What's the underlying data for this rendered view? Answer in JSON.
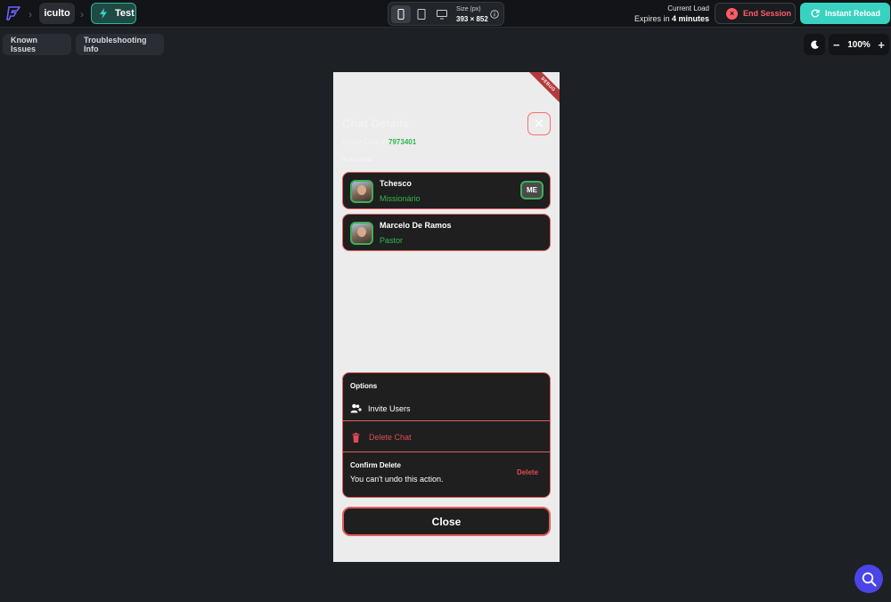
{
  "topbar": {
    "project_name": "iculto",
    "test_label": "Test",
    "size_label": "Size (px)",
    "size_value": "393 × 852",
    "load_label": "Current Load",
    "expires_prefix": "Expires in",
    "expires_value": "4 minutes",
    "end_session_label": "End Session",
    "instant_reload_label": "Instant Reload"
  },
  "subbar": {
    "known_issues_label": "Known Issues",
    "troubleshooting_label": "Troubleshooting Info",
    "zoom_minus": "−",
    "zoom_value": "100%",
    "zoom_plus": "+"
  },
  "phone": {
    "debug_banner": "DEBUG",
    "title": "Chat Details",
    "group_chat_label": "Group Chat #",
    "group_chat_id": "7973401",
    "in_chat_label": "In this chat",
    "members": [
      {
        "name": "Tchesco",
        "role": "Missionário",
        "badge": "ME"
      },
      {
        "name": "Marcelo De Ramos",
        "role": "Pastor"
      }
    ],
    "options": {
      "title": "Options",
      "invite_label": "Invite Users",
      "delete_label": "Delete Chat",
      "confirm_title": "Confirm Delete",
      "confirm_text": "You can't undo this action.",
      "confirm_button": "Delete"
    },
    "close_label": "Close"
  },
  "colors": {
    "accent_teal": "#39d2c0",
    "danger": "#e14a55",
    "success_green": "#2fb84f",
    "fab_purple": "#4b44e6"
  }
}
